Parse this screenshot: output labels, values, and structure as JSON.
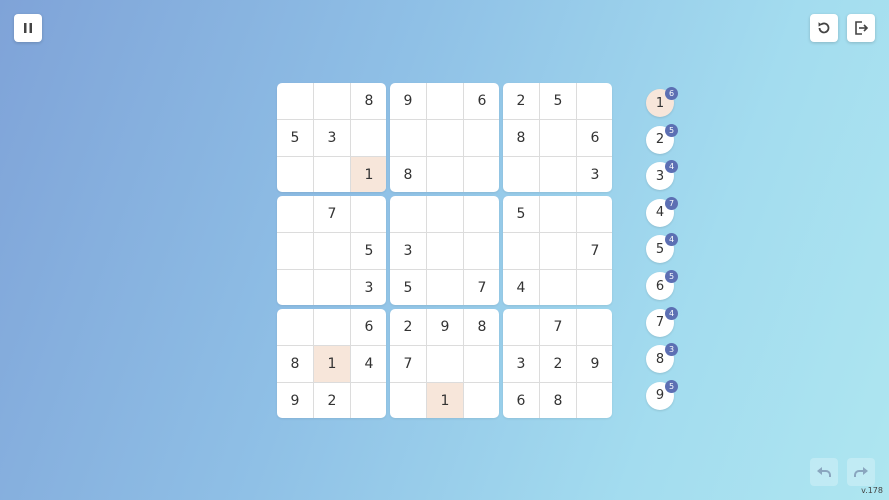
{
  "board": {
    "rows": [
      [
        "",
        "",
        "8",
        "9",
        "",
        "6",
        "2",
        "5",
        ""
      ],
      [
        "5",
        "3",
        "",
        "",
        "",
        "",
        "8",
        "",
        "6"
      ],
      [
        "",
        "",
        "1",
        "8",
        "",
        "",
        "",
        "",
        "3"
      ],
      [
        "",
        "7",
        "",
        "",
        "",
        "",
        "5",
        "",
        ""
      ],
      [
        "",
        "",
        "5",
        "3",
        "",
        "",
        "",
        "",
        "7"
      ],
      [
        "",
        "",
        "3",
        "5",
        "",
        "7",
        "4",
        "",
        ""
      ],
      [
        "",
        "",
        "6",
        "2",
        "9",
        "8",
        "",
        "7",
        ""
      ],
      [
        "8",
        "1",
        "4",
        "7",
        "",
        "",
        "3",
        "2",
        "9"
      ],
      [
        "9",
        "2",
        "",
        "",
        "1",
        "",
        "6",
        "8",
        ""
      ]
    ],
    "highlighted_cells": [
      [
        2,
        2
      ],
      [
        7,
        1
      ],
      [
        8,
        4
      ]
    ]
  },
  "number_picker": [
    {
      "digit": "1",
      "remaining": "6",
      "selected": true
    },
    {
      "digit": "2",
      "remaining": "5",
      "selected": false
    },
    {
      "digit": "3",
      "remaining": "4",
      "selected": false
    },
    {
      "digit": "4",
      "remaining": "7",
      "selected": false
    },
    {
      "digit": "5",
      "remaining": "4",
      "selected": false
    },
    {
      "digit": "6",
      "remaining": "5",
      "selected": false
    },
    {
      "digit": "7",
      "remaining": "4",
      "selected": false
    },
    {
      "digit": "8",
      "remaining": "3",
      "selected": false
    },
    {
      "digit": "9",
      "remaining": "5",
      "selected": false
    }
  ],
  "toolbar": {
    "pause_icon": "pause-icon",
    "restart_icon": "restart-icon",
    "exit_icon": "exit-icon",
    "undo_icon": "undo-icon",
    "redo_icon": "redo-icon"
  },
  "version": "v.178",
  "colors": {
    "highlight": "#f7e6da",
    "badge": "#5c6fb3",
    "text": "#333333"
  }
}
